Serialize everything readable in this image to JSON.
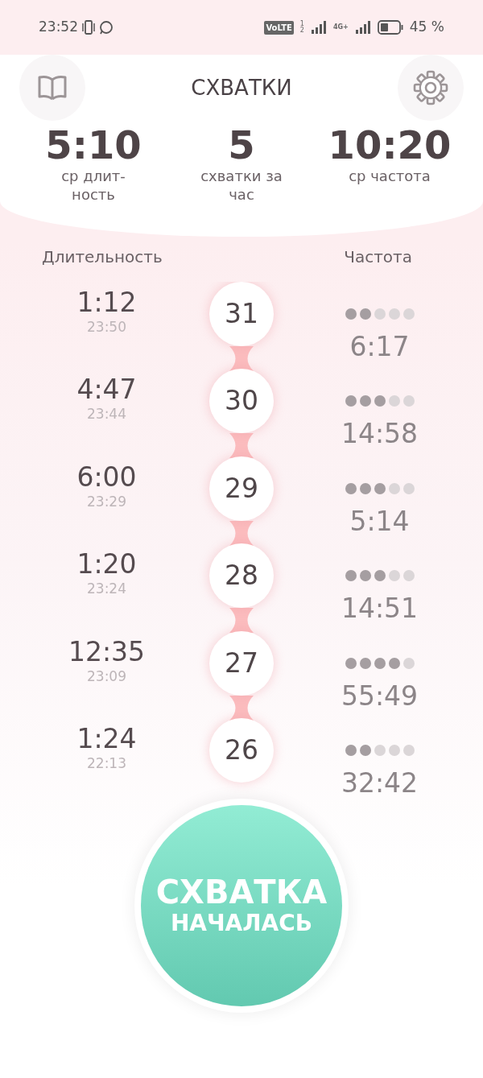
{
  "status_bar": {
    "time": "23:52",
    "volte": "VoLTE",
    "sim_slots": [
      "1",
      "2"
    ],
    "network": "4G+",
    "battery": "45 %"
  },
  "header": {
    "title": "СХВАТКИ"
  },
  "stats": [
    {
      "value": "5:10",
      "label": "ср длит-ность"
    },
    {
      "value": "5",
      "label": "схватки за час"
    },
    {
      "value": "10:20",
      "label": "ср частота"
    }
  ],
  "columns": {
    "duration": "Длительность",
    "frequency": "Частота"
  },
  "contractions": [
    {
      "duration": "1:12",
      "start": "23:50",
      "number": "31",
      "stars": 2,
      "frequency": "6:17"
    },
    {
      "duration": "4:47",
      "start": "23:44",
      "number": "30",
      "stars": 3,
      "frequency": "14:58"
    },
    {
      "duration": "6:00",
      "start": "23:29",
      "number": "29",
      "stars": 3,
      "frequency": "5:14"
    },
    {
      "duration": "1:20",
      "start": "23:24",
      "number": "28",
      "stars": 3,
      "frequency": "14:51"
    },
    {
      "duration": "12:35",
      "start": "23:09",
      "number": "27",
      "stars": 4,
      "frequency": "55:49"
    },
    {
      "duration": "1:24",
      "start": "22:13",
      "number": "26",
      "stars": 2,
      "frequency": "32:42"
    }
  ],
  "start_button": {
    "line_1": "СХВАТКА",
    "line_2": "НАЧАЛАСЬ"
  }
}
